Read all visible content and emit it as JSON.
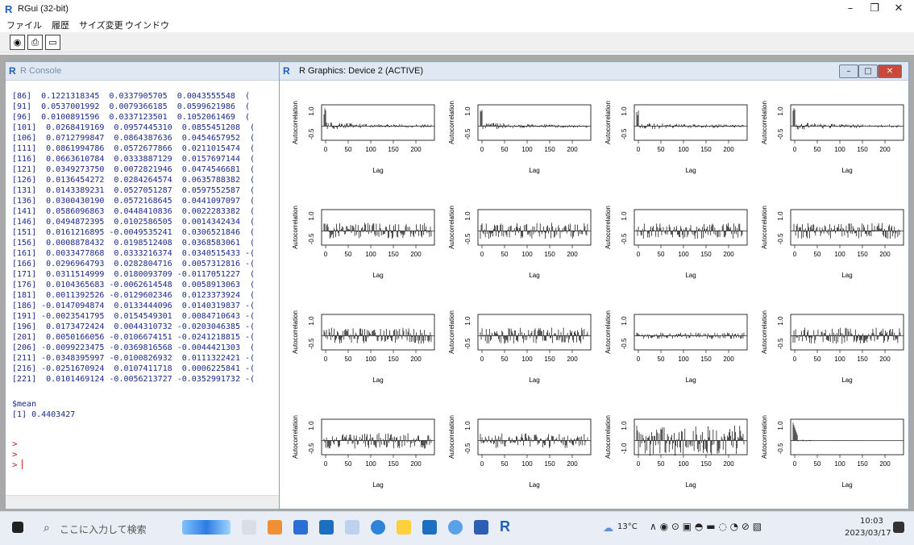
{
  "app": {
    "title": "RGui (32-bit)"
  },
  "menu": [
    "ファイル",
    "履歴",
    "サイズ変更",
    "ウインドウ"
  ],
  "window_controls": {
    "minimize": "–",
    "restore": "❐",
    "close": "✕"
  },
  "toolbar_icons": [
    "camera-icon",
    "print-icon",
    "window-icon"
  ],
  "console": {
    "title": "R Console",
    "lines": [
      "[86]  0.1221318345  0.0337905705  0.0043555548  (",
      "[91]  0.0537001992  0.0079366185  0.0599621986  (",
      "[96]  0.0100891596  0.0337123501  0.1052061469  (",
      "[101]  0.0268419169  0.0957445310  0.0855451208  (",
      "[106]  0.0712799847  0.0864387636  0.0454657952  (",
      "[111]  0.0861994786  0.0572677866  0.0211015474  (",
      "[116]  0.0663610784  0.0333887129  0.0157697144  (",
      "[121]  0.0349273750  0.0072821946  0.0474546681  (",
      "[126]  0.0136454272  0.0284264574  0.0635788382  (",
      "[131]  0.0143389231  0.0527051287  0.0597552587  (",
      "[136]  0.0300430190  0.0572168645  0.0441097097  (",
      "[141]  0.0586096863  0.0448410836  0.0022283382  (",
      "[146]  0.0494872395  0.0102586505  0.0014342434  (",
      "[151]  0.0161216895 -0.0049535241  0.0306521846  (",
      "[156]  0.0008878432  0.0198512408  0.0368583061  (",
      "[161]  0.0033477868  0.0333216374  0.0340515433 -(",
      "[166]  0.0296964793  0.0282804716  0.0057312816 -(",
      "[171]  0.0311514999  0.0180093709 -0.0117051227  (",
      "[176]  0.0104365683 -0.0062614548  0.0058913063  (",
      "[181]  0.0011392526 -0.0129602346  0.0123373924  (",
      "[186] -0.0147094874  0.0133444096  0.0140319837 -(",
      "[191] -0.0023541795  0.0154549301  0.0084710643 -(",
      "[196]  0.0173472424  0.0044310732 -0.0203046385 -(",
      "[201]  0.0050166056 -0.0106674151 -0.0241218815 -(",
      "[206] -0.0099223475 -0.0369816568 -0.0044421303  (",
      "[211] -0.0348395997 -0.0100826932  0.0111322421 -(",
      "[216] -0.0251670924  0.0107411718  0.0006225841 -(",
      "[221]  0.0101469124 -0.0056213727 -0.0352991732 -("
    ],
    "mean_label": "$mean",
    "mean_value": "[1] 0.4403427",
    "prompts": [
      ">",
      ">",
      ">"
    ]
  },
  "graphics": {
    "title": "R Graphics: Device 2 (ACTIVE)",
    "buttons": [
      "–",
      "□",
      "✕"
    ],
    "ylabel": "Autocorrelation",
    "xlabel": "Lag",
    "xticks": [
      "0",
      "50",
      "100",
      "150",
      "200"
    ],
    "yticks": [
      "1.0",
      "-0.5"
    ],
    "yticks_last": [
      "1.0",
      "-1.0"
    ],
    "styles": [
      "decay",
      "decay",
      "decay",
      "decay",
      "noisy",
      "noisy",
      "noisy",
      "noisy",
      "noisy",
      "noisy",
      "small",
      "noisy",
      "noisy",
      "dense",
      "full",
      "tail"
    ]
  },
  "taskbar": {
    "search_placeholder": "ここに入力して検索",
    "weather": "13°C",
    "time": "10:03",
    "date": "2023/03/17"
  }
}
